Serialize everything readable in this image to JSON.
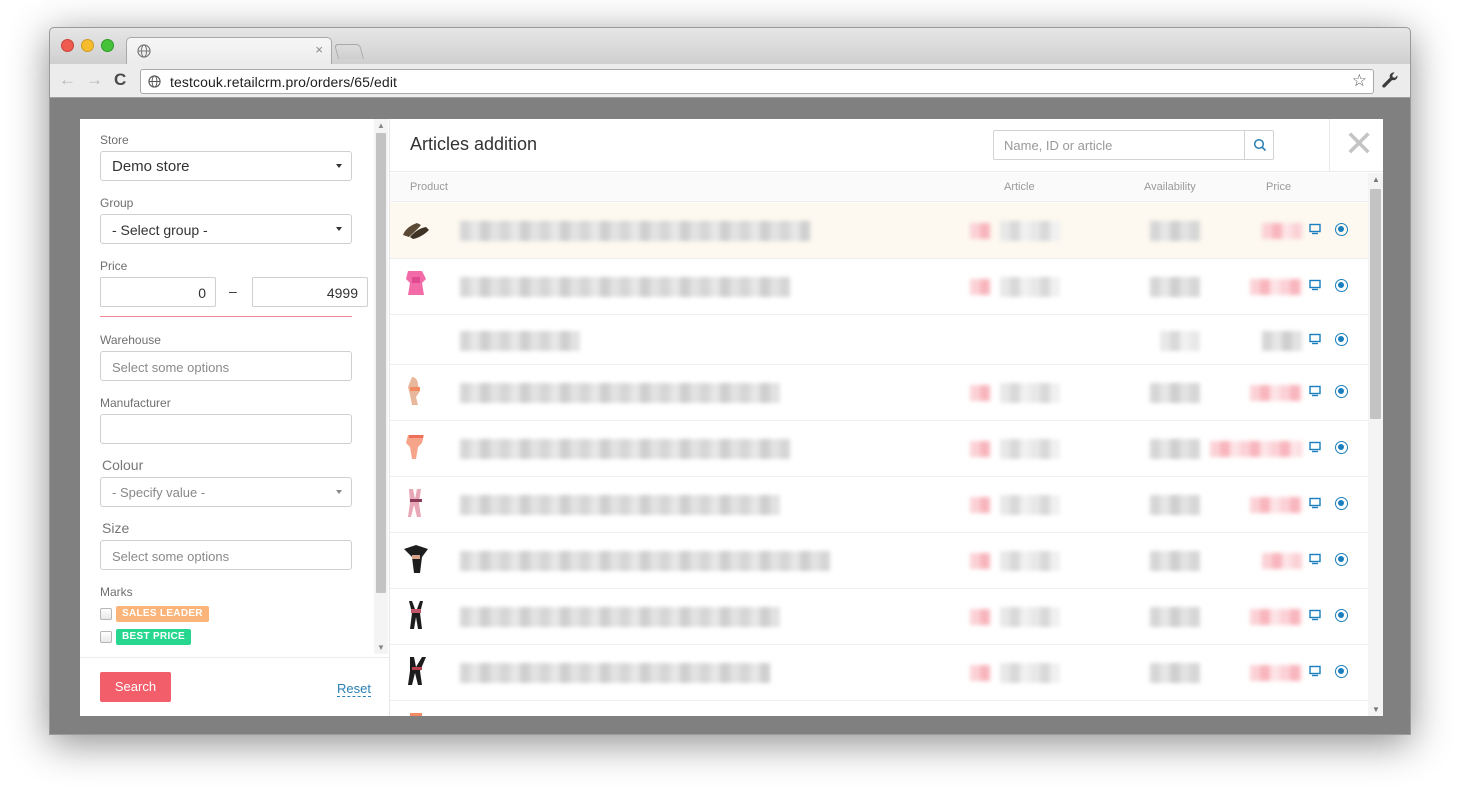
{
  "browser": {
    "url": "testcouk.retailcrm.pro/orders/65/edit",
    "tab_close_glyph": "×",
    "back_glyph": "←",
    "forward_glyph": "→",
    "reload_glyph": "C",
    "star_glyph": "☆"
  },
  "filters": {
    "store_label": "Store",
    "store_value": "Demo store",
    "group_label": "Group",
    "group_value": "- Select group -",
    "price_label": "Price",
    "price_min": "0",
    "price_separator": "–",
    "price_max": "4999",
    "warehouse_label": "Warehouse",
    "warehouse_placeholder": "Select some options",
    "manufacturer_label": "Manufacturer",
    "manufacturer_value": "",
    "colour_label": "Colour",
    "colour_value": "- Specify value -",
    "size_label": "Size",
    "size_placeholder": "Select some options",
    "marks_label": "Marks",
    "marks": [
      {
        "label": "SALES LEADER",
        "color": "#fbb57b"
      },
      {
        "label": "BEST PRICE",
        "color": "#27d68f"
      }
    ],
    "search_button": "Search",
    "reset_link": "Reset"
  },
  "articles": {
    "title": "Articles addition",
    "search_placeholder": "Name, ID or article",
    "close_glyph": "✕",
    "columns": {
      "product": "Product",
      "article": "Article",
      "availability": "Availability",
      "price": "Price"
    }
  },
  "colors": {
    "accent_red": "#f25f6b",
    "link_blue": "#2a7fb5",
    "icon_blue": "#1a7fbf"
  }
}
